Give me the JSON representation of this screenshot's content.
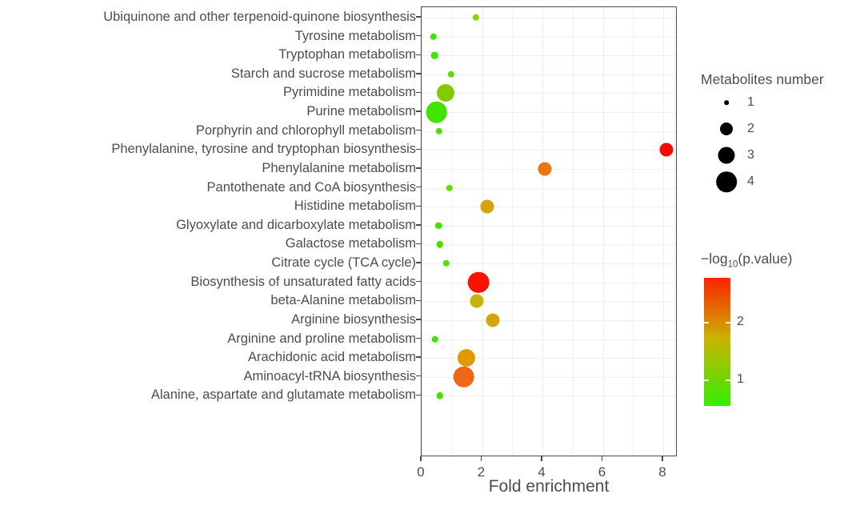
{
  "chart_data": {
    "type": "scatter",
    "title": "",
    "xlabel": "Fold enrichment",
    "ylabel": "",
    "xlim": [
      0,
      8.6
    ],
    "xticks": [
      0,
      2,
      4,
      6,
      8
    ],
    "xticklabels": [
      "0",
      "2",
      "4",
      "6",
      "8"
    ],
    "grid": true,
    "legend_position": "right",
    "size_legend": {
      "title": "Metabolites number",
      "values": [
        1,
        2,
        3,
        4
      ],
      "labels": [
        "1",
        "2",
        "3",
        "4"
      ]
    },
    "color_legend": {
      "title": "−log10(p.value)",
      "title_prefix": "−log",
      "title_sub": "10",
      "title_suffix": "(p.value)",
      "ticks": [
        1,
        2
      ],
      "ticklabels": [
        "1",
        "2"
      ],
      "range": [
        0.55,
        2.75
      ],
      "low_color": "#33EE00",
      "mid_color": "#C8B400",
      "high_color": "#FF2200"
    },
    "categories": [
      "Ubiquinone and other terpenoid-quinone biosynthesis",
      "Tyrosine metabolism",
      "Tryptophan metabolism",
      "Starch and sucrose metabolism",
      "Pyrimidine metabolism",
      "Purine metabolism",
      "Porphyrin and chlorophyll metabolism",
      "Phenylalanine, tyrosine and tryptophan biosynthesis",
      "Phenylalanine metabolism",
      "Pantothenate and CoA biosynthesis",
      "Histidine metabolism",
      "Glyoxylate and dicarboxylate metabolism",
      "Galactose metabolism",
      "Citrate cycle (TCA cycle)",
      "Biosynthesis of unsaturated fatty acids",
      "beta-Alanine metabolism",
      "Arginine biosynthesis",
      "Arginine and proline metabolism",
      "Arachidonic acid metabolism",
      "Aminoacyl-tRNA biosynthesis",
      "Alanine, aspartate and glutamate metabolism"
    ],
    "points": [
      {
        "pathway": "Ubiquinone and other terpenoid-quinone biosynthesis",
        "fold_enrichment": 1.8,
        "metabolites_number": 1,
        "neglog10p": 1.0,
        "color": "#8FD000"
      },
      {
        "pathway": "Tyrosine metabolism",
        "fold_enrichment": 0.4,
        "metabolites_number": 1,
        "neglog10p": 0.6,
        "color": "#3FE400"
      },
      {
        "pathway": "Tryptophan metabolism",
        "fold_enrichment": 0.43,
        "metabolites_number": 1,
        "neglog10p": 0.6,
        "color": "#3FE400"
      },
      {
        "pathway": "Starch and sucrose metabolism",
        "fold_enrichment": 0.98,
        "metabolites_number": 1,
        "neglog10p": 0.78,
        "color": "#63D900"
      },
      {
        "pathway": "Pyrimidine metabolism",
        "fold_enrichment": 0.8,
        "metabolites_number": 3,
        "neglog10p": 1.0,
        "color": "#86C903"
      },
      {
        "pathway": "Purine metabolism",
        "fold_enrichment": 0.5,
        "metabolites_number": 4,
        "neglog10p": 0.62,
        "color": "#44E200"
      },
      {
        "pathway": "Porphyrin and chlorophyll metabolism",
        "fold_enrichment": 0.58,
        "metabolites_number": 1,
        "neglog10p": 0.68,
        "color": "#4FDF00"
      },
      {
        "pathway": "Phenylalanine, tyrosine and tryptophan biosynthesis",
        "fold_enrichment": 8.1,
        "metabolites_number": 2,
        "neglog10p": 2.75,
        "color": "#FA0A00"
      },
      {
        "pathway": "Phenylalanine metabolism",
        "fold_enrichment": 4.08,
        "metabolites_number": 2,
        "neglog10p": 2.3,
        "color": "#E87711"
      },
      {
        "pathway": "Pantothenate and CoA biosynthesis",
        "fold_enrichment": 0.93,
        "metabolites_number": 1,
        "neglog10p": 0.8,
        "color": "#6ED700"
      },
      {
        "pathway": "Histidine metabolism",
        "fold_enrichment": 2.17,
        "metabolites_number": 2,
        "neglog10p": 1.7,
        "color": "#D3A408"
      },
      {
        "pathway": "Glyoxylate and dicarboxylate metabolism",
        "fold_enrichment": 0.56,
        "metabolites_number": 1,
        "neglog10p": 0.62,
        "color": "#44E200"
      },
      {
        "pathway": "Galactose metabolism",
        "fold_enrichment": 0.61,
        "metabolites_number": 1,
        "neglog10p": 0.64,
        "color": "#46E100"
      },
      {
        "pathway": "Citrate cycle (TCA cycle)",
        "fold_enrichment": 0.82,
        "metabolites_number": 1,
        "neglog10p": 0.72,
        "color": "#55DC00"
      },
      {
        "pathway": "Biosynthesis of unsaturated fatty acids",
        "fold_enrichment": 1.88,
        "metabolites_number": 4,
        "neglog10p": 2.7,
        "color": "#FA1400"
      },
      {
        "pathway": "beta-Alanine metabolism",
        "fold_enrichment": 1.83,
        "metabolites_number": 2,
        "neglog10p": 1.55,
        "color": "#C6B400"
      },
      {
        "pathway": "Arginine biosynthesis",
        "fold_enrichment": 2.36,
        "metabolites_number": 2,
        "neglog10p": 1.72,
        "color": "#D4A40A"
      },
      {
        "pathway": "Arginine and proline metabolism",
        "fold_enrichment": 0.45,
        "metabolites_number": 1,
        "neglog10p": 0.6,
        "color": "#3FE400"
      },
      {
        "pathway": "Arachidonic acid metabolism",
        "fold_enrichment": 1.48,
        "metabolites_number": 3,
        "neglog10p": 1.95,
        "color": "#E09A00"
      },
      {
        "pathway": "Aminoacyl-tRNA biosynthesis",
        "fold_enrichment": 1.4,
        "metabolites_number": 4,
        "neglog10p": 2.22,
        "color": "#F2661A"
      },
      {
        "pathway": "Alanine, aspartate and glutamate metabolism",
        "fold_enrichment": 0.61,
        "metabolites_number": 1,
        "neglog10p": 0.62,
        "color": "#44E200"
      }
    ]
  }
}
